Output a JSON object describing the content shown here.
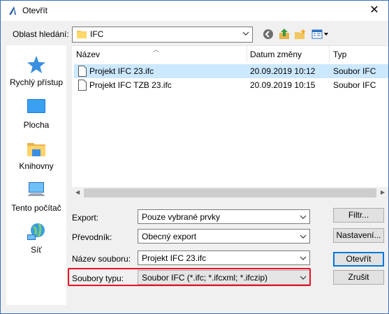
{
  "window": {
    "title": "Otevřít",
    "close_glyph": "✕"
  },
  "lookin": {
    "label": "Oblast hledání:",
    "value": "IFC"
  },
  "toolbar": {
    "icons": [
      "back-icon",
      "up-folder-icon",
      "new-folder-icon",
      "view-menu-icon"
    ]
  },
  "places": [
    {
      "label": "Rychlý přístup",
      "icon": "star-icon"
    },
    {
      "label": "Plocha",
      "icon": "desktop-icon"
    },
    {
      "label": "Knihovny",
      "icon": "libraries-icon"
    },
    {
      "label": "Tento počítač",
      "icon": "computer-icon"
    },
    {
      "label": "Síť",
      "icon": "network-icon"
    }
  ],
  "filelist": {
    "columns": [
      "Název",
      "Datum změny",
      "Typ"
    ],
    "rows": [
      {
        "name": "Projekt IFC 23.ifc",
        "date": "20.09.2019 10:12",
        "type": "Soubor IFC",
        "selected": true
      },
      {
        "name": "Projekt IFC TZB 23.ifc",
        "date": "20.09.2019 10:15",
        "type": "Soubor IFC",
        "selected": false
      }
    ]
  },
  "fields": {
    "export": {
      "label": "Export:",
      "value": "Pouze vybrané prvky"
    },
    "converter": {
      "label": "Převodník:",
      "value": "Obecný export"
    },
    "filename": {
      "label": "Název souboru:",
      "value": "Projekt IFC 23.ifc"
    },
    "filetype": {
      "label": "Soubory typu:",
      "value": "Soubor IFC (*.ifc; *.ifcxml; *.ifczip)"
    }
  },
  "buttons": {
    "filter": "Filtr...",
    "settings": "Nastavení...",
    "open": "Otevřít",
    "cancel": "Zrušit"
  },
  "colors": {
    "selection": "#cce8ff",
    "highlight_box": "#e81123",
    "accent": "#0078d7"
  }
}
